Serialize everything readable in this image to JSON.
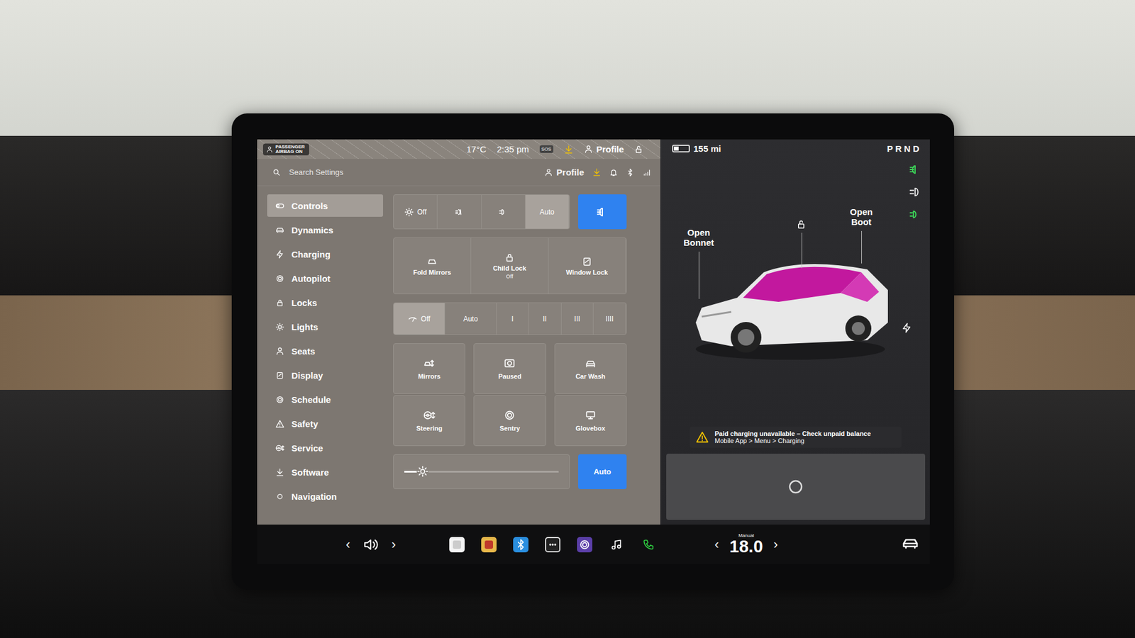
{
  "status_bar": {
    "airbag": "PASSENGER AIRBAG ON",
    "temperature": "17°C",
    "time": "2:35 pm",
    "sos": "SOS",
    "profile": "Profile"
  },
  "settings_header": {
    "search_placeholder": "Search Settings",
    "profile": "Profile"
  },
  "sidebar": {
    "items": [
      {
        "label": "Controls",
        "selected": true
      },
      {
        "label": "Dynamics",
        "selected": false
      },
      {
        "label": "Charging",
        "selected": false
      },
      {
        "label": "Autopilot",
        "selected": false
      },
      {
        "label": "Locks",
        "selected": false
      },
      {
        "label": "Lights",
        "selected": false
      },
      {
        "label": "Seats",
        "selected": false
      },
      {
        "label": "Display",
        "selected": false
      },
      {
        "label": "Schedule",
        "selected": false
      },
      {
        "label": "Safety",
        "selected": false
      },
      {
        "label": "Service",
        "selected": false
      },
      {
        "label": "Software",
        "selected": false
      },
      {
        "label": "Navigation",
        "selected": false
      }
    ]
  },
  "lights": [
    {
      "kind": "off",
      "label": "Off",
      "selected": false
    },
    {
      "kind": "fog",
      "label": "",
      "selected": false
    },
    {
      "kind": "parking",
      "label": "",
      "selected": false
    },
    {
      "kind": "auto",
      "label": "Auto",
      "selected": true
    }
  ],
  "headlight_button": {
    "on": true
  },
  "quick": [
    {
      "label": "Fold Mirrors",
      "sub": "",
      "kind": "mirror"
    },
    {
      "label": "Child Lock",
      "sub": "Off",
      "kind": "lock"
    },
    {
      "label": "Window Lock",
      "sub": "",
      "kind": "window"
    }
  ],
  "wipers": [
    {
      "label": "Off",
      "kind": "off",
      "selected": true
    },
    {
      "label": "Auto",
      "kind": "text",
      "selected": false
    },
    {
      "label": "I",
      "kind": "text",
      "selected": false
    },
    {
      "label": "II",
      "kind": "text",
      "selected": false
    },
    {
      "label": "III",
      "kind": "text",
      "selected": false
    },
    {
      "label": "IIII",
      "kind": "text",
      "selected": false
    }
  ],
  "tiles": [
    {
      "label": "Mirrors",
      "kind": "mirrors"
    },
    {
      "label": "Paused",
      "kind": "camera"
    },
    {
      "label": "Car Wash",
      "kind": "carwash"
    },
    {
      "label": "Steering",
      "kind": "steering"
    },
    {
      "label": "Sentry",
      "kind": "sentry"
    },
    {
      "label": "Glovebox",
      "kind": "glovebox"
    }
  ],
  "brightness": {
    "level": 0.12,
    "auto_label": "Auto",
    "auto_on": true
  },
  "vehicle": {
    "range": "155 mi",
    "battery_level": 0.35,
    "gears": "PRND",
    "open_bonnet": "Open Bonnet",
    "open_boot": "Open Boot"
  },
  "indicators": [
    {
      "kind": "headlight",
      "color": "#3ddc5a"
    },
    {
      "kind": "auto",
      "color": "#e8e8e8"
    },
    {
      "kind": "parking",
      "color": "#3ddc5a"
    }
  ],
  "warning": {
    "title": "Paid charging unavailable – Check unpaid balance",
    "path": "Mobile App > Menu > Charging"
  },
  "climate": {
    "mode": "Manual",
    "temperature": "18.0",
    "left_arrow": "‹",
    "right_arrow": "›"
  },
  "volume": {
    "left_arrow": "‹",
    "right_arrow": "›"
  }
}
